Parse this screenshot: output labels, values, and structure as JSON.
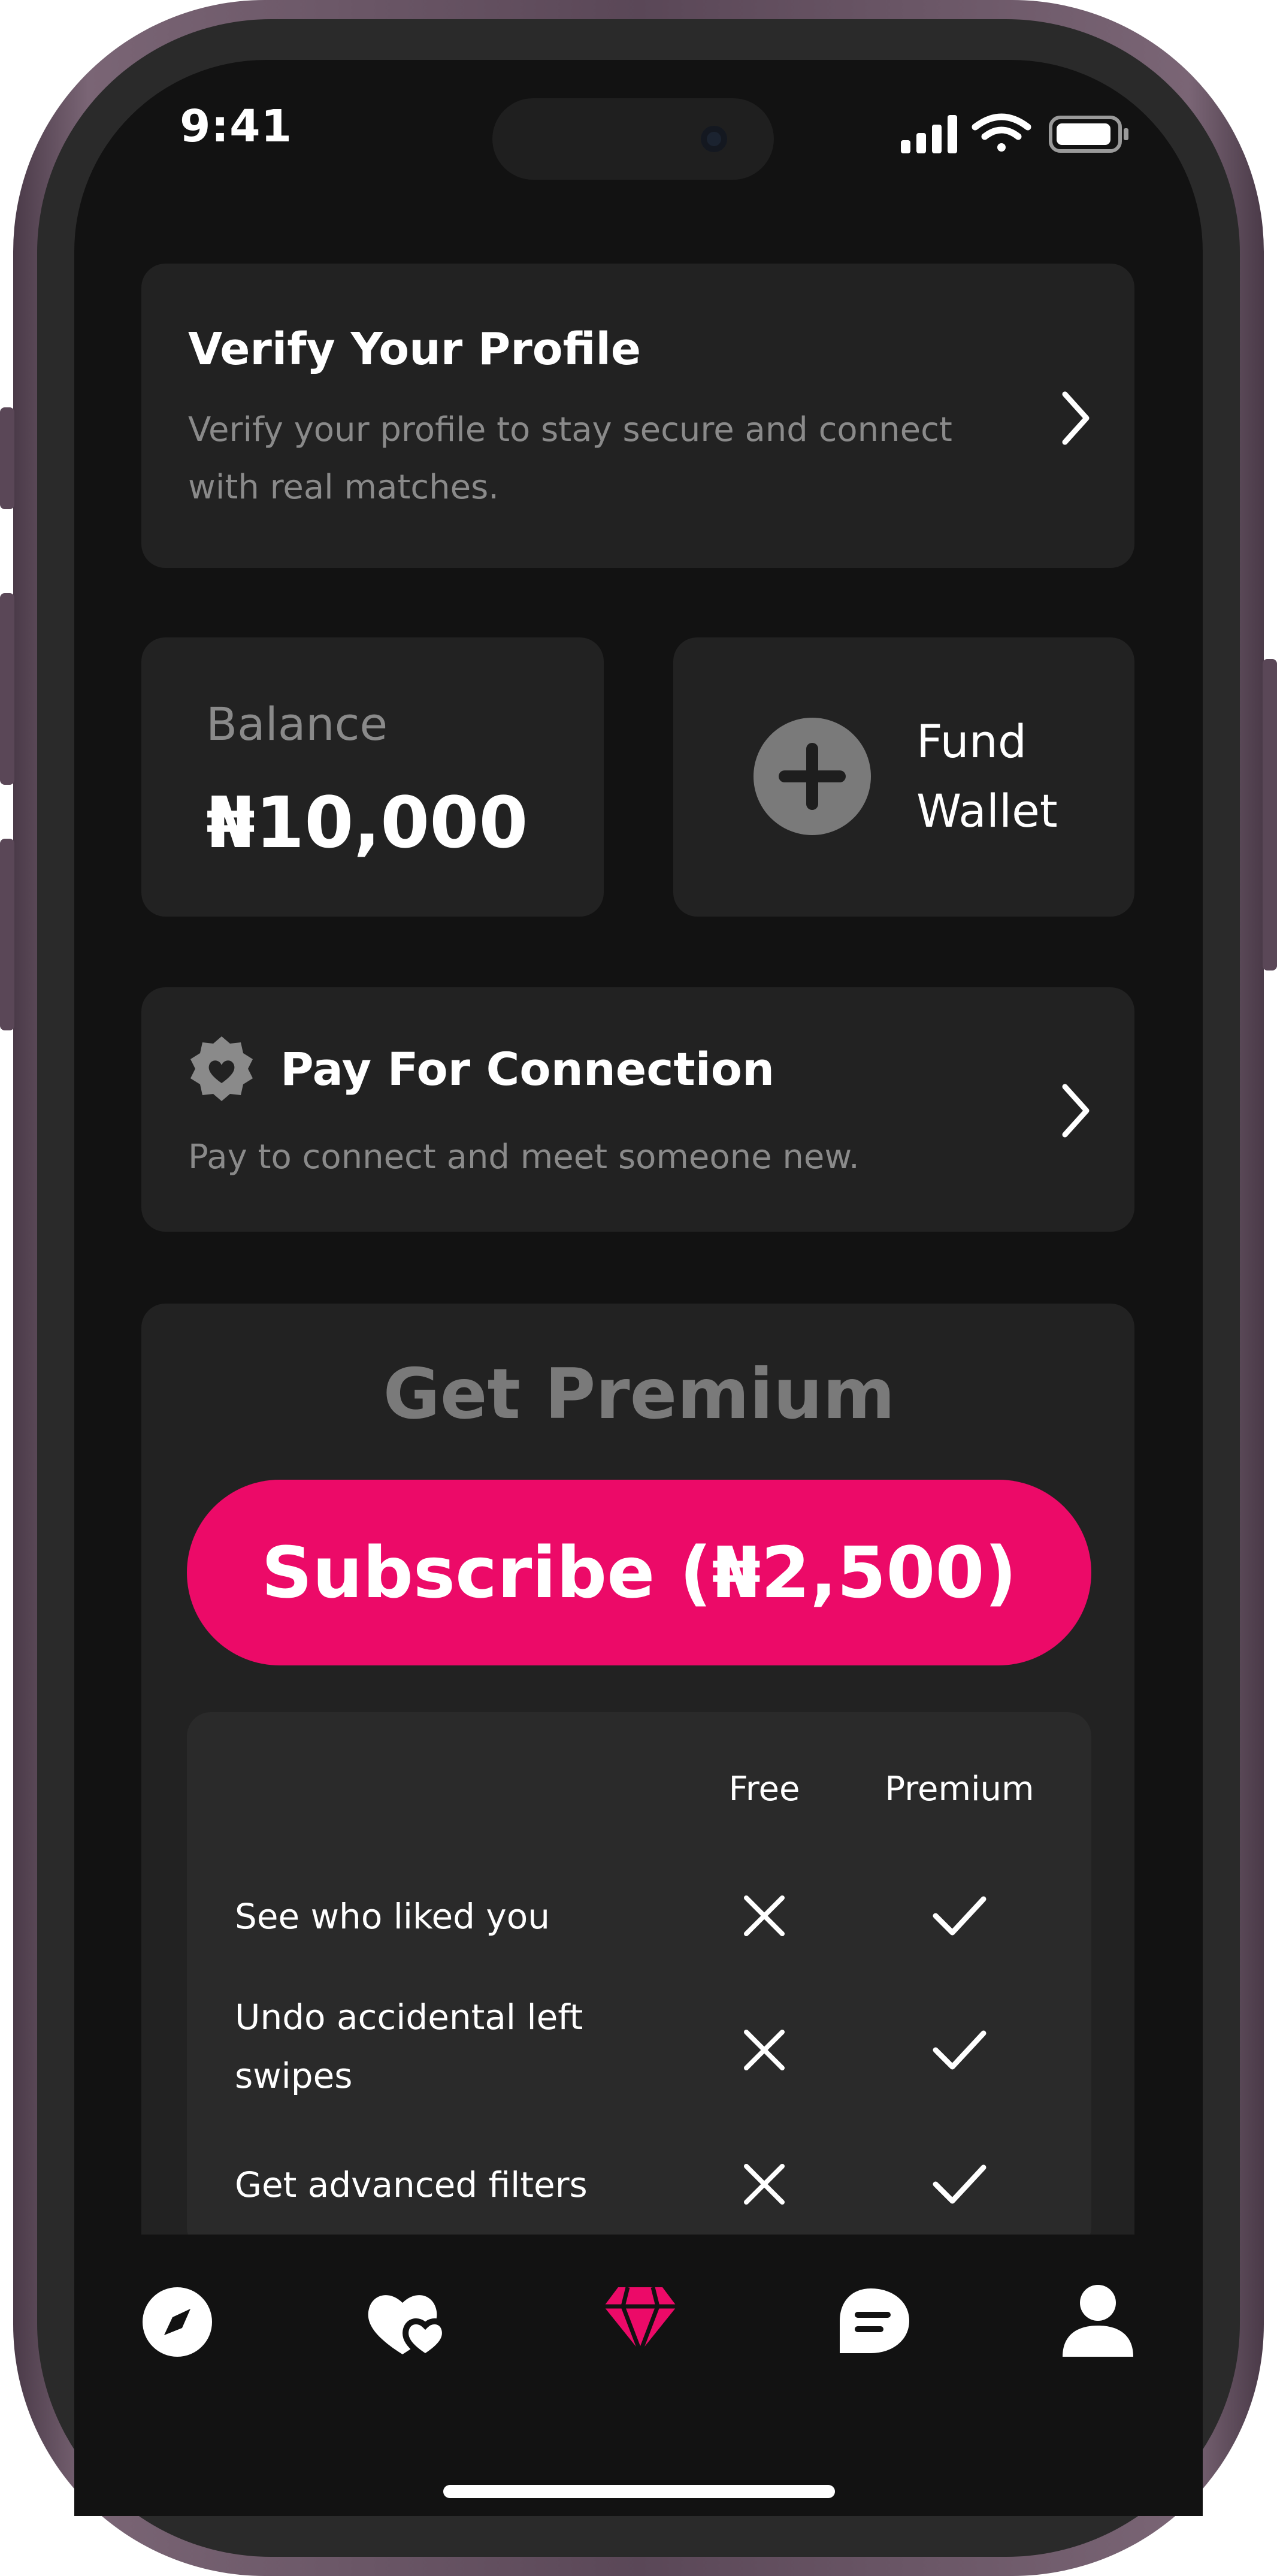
{
  "status_bar": {
    "time": "9:41"
  },
  "verify_card": {
    "title": "Verify Your Profile",
    "description_line1": "Verify your profile to stay secure and connect",
    "description_line2": "with real matches."
  },
  "balance_card": {
    "label": "Balance",
    "value": "₦10,000"
  },
  "fund_card": {
    "label_line1": "Fund",
    "label_line2": "Wallet"
  },
  "connection_card": {
    "title": "Pay For Connection",
    "description": "Pay to connect and meet someone new."
  },
  "premium": {
    "title": "Get Premium",
    "subscribe_label": "Subscribe (₦2,500)",
    "columns": [
      "Free",
      "Premium"
    ],
    "features": [
      {
        "label": "See who liked you",
        "free": false,
        "premium": true
      },
      {
        "label_line1": "Undo accidental left",
        "label_line2": "swipes",
        "free": false,
        "premium": true
      },
      {
        "label": "Get advanced filters",
        "free": false,
        "premium": true
      }
    ]
  },
  "tab_bar": {
    "tabs": [
      {
        "icon": "compass-icon",
        "active": false
      },
      {
        "icon": "hearts-icon",
        "active": false
      },
      {
        "icon": "diamond-icon",
        "active": true
      },
      {
        "icon": "chat-icon",
        "active": false
      },
      {
        "icon": "profile-icon",
        "active": false
      }
    ]
  },
  "colors": {
    "accent": "#ec0a68",
    "background": "#121212",
    "card": "#222222",
    "muted_text": "#8a8a8a"
  }
}
